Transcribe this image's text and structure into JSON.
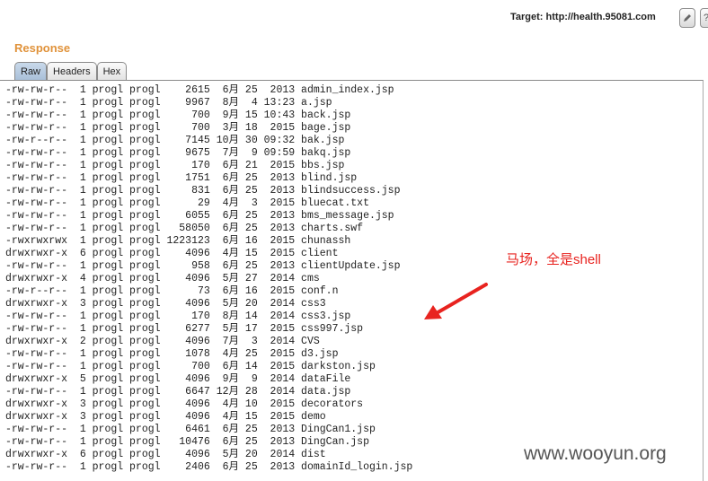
{
  "header": {
    "target_label": "Target: http://health.95081.com",
    "edit_icon": "pencil-icon",
    "help_icon": "help-icon",
    "help_glyph": "?"
  },
  "response": {
    "title": "Response",
    "tabs": [
      {
        "label": "Raw",
        "active": true
      },
      {
        "label": "Headers",
        "active": false
      },
      {
        "label": "Hex",
        "active": false
      }
    ]
  },
  "listing": [
    {
      "perms": "-rw-rw-r--",
      "links": "1",
      "owner": "progl",
      "group": "progl",
      "size": "2615",
      "month": "6月",
      "day": "25",
      "time": "2013",
      "name": "admin_index.jsp"
    },
    {
      "perms": "-rw-rw-r--",
      "links": "1",
      "owner": "progl",
      "group": "progl",
      "size": "9967",
      "month": "8月",
      "day": "4",
      "time": "13:23",
      "name": "a.jsp"
    },
    {
      "perms": "-rw-rw-r--",
      "links": "1",
      "owner": "progl",
      "group": "progl",
      "size": "700",
      "month": "9月",
      "day": "15",
      "time": "10:43",
      "name": "back.jsp"
    },
    {
      "perms": "-rw-rw-r--",
      "links": "1",
      "owner": "progl",
      "group": "progl",
      "size": "700",
      "month": "3月",
      "day": "18",
      "time": "2015",
      "name": "bage.jsp"
    },
    {
      "perms": "-rw-r--r--",
      "links": "1",
      "owner": "progl",
      "group": "progl",
      "size": "7145",
      "month": "10月",
      "day": "30",
      "time": "09:32",
      "name": "bak.jsp"
    },
    {
      "perms": "-rw-rw-r--",
      "links": "1",
      "owner": "progl",
      "group": "progl",
      "size": "9675",
      "month": "7月",
      "day": "9",
      "time": "09:59",
      "name": "bakq.jsp"
    },
    {
      "perms": "-rw-rw-r--",
      "links": "1",
      "owner": "progl",
      "group": "progl",
      "size": "170",
      "month": "6月",
      "day": "21",
      "time": "2015",
      "name": "bbs.jsp"
    },
    {
      "perms": "-rw-rw-r--",
      "links": "1",
      "owner": "progl",
      "group": "progl",
      "size": "1751",
      "month": "6月",
      "day": "25",
      "time": "2013",
      "name": "blind.jsp"
    },
    {
      "perms": "-rw-rw-r--",
      "links": "1",
      "owner": "progl",
      "group": "progl",
      "size": "831",
      "month": "6月",
      "day": "25",
      "time": "2013",
      "name": "blindsuccess.jsp"
    },
    {
      "perms": "-rw-rw-r--",
      "links": "1",
      "owner": "progl",
      "group": "progl",
      "size": "29",
      "month": "4月",
      "day": "3",
      "time": "2015",
      "name": "bluecat.txt"
    },
    {
      "perms": "-rw-rw-r--",
      "links": "1",
      "owner": "progl",
      "group": "progl",
      "size": "6055",
      "month": "6月",
      "day": "25",
      "time": "2013",
      "name": "bms_message.jsp"
    },
    {
      "perms": "-rw-rw-r--",
      "links": "1",
      "owner": "progl",
      "group": "progl",
      "size": "58050",
      "month": "6月",
      "day": "25",
      "time": "2013",
      "name": "charts.swf"
    },
    {
      "perms": "-rwxrwxrwx",
      "links": "1",
      "owner": "progl",
      "group": "progl",
      "size": "1223123",
      "month": "6月",
      "day": "16",
      "time": "2015",
      "name": "chunassh"
    },
    {
      "perms": "drwxrwxr-x",
      "links": "6",
      "owner": "progl",
      "group": "progl",
      "size": "4096",
      "month": "4月",
      "day": "15",
      "time": "2015",
      "name": "client"
    },
    {
      "perms": "-rw-rw-r--",
      "links": "1",
      "owner": "progl",
      "group": "progl",
      "size": "958",
      "month": "6月",
      "day": "25",
      "time": "2013",
      "name": "clientUpdate.jsp"
    },
    {
      "perms": "drwxrwxr-x",
      "links": "4",
      "owner": "progl",
      "group": "progl",
      "size": "4096",
      "month": "5月",
      "day": "27",
      "time": "2014",
      "name": "cms"
    },
    {
      "perms": "-rw-r--r--",
      "links": "1",
      "owner": "progl",
      "group": "progl",
      "size": "73",
      "month": "6月",
      "day": "16",
      "time": "2015",
      "name": "conf.n"
    },
    {
      "perms": "drwxrwxr-x",
      "links": "3",
      "owner": "progl",
      "group": "progl",
      "size": "4096",
      "month": "5月",
      "day": "20",
      "time": "2014",
      "name": "css3"
    },
    {
      "perms": "-rw-rw-r--",
      "links": "1",
      "owner": "progl",
      "group": "progl",
      "size": "170",
      "month": "8月",
      "day": "14",
      "time": "2014",
      "name": "css3.jsp"
    },
    {
      "perms": "-rw-rw-r--",
      "links": "1",
      "owner": "progl",
      "group": "progl",
      "size": "6277",
      "month": "5月",
      "day": "17",
      "time": "2015",
      "name": "css997.jsp"
    },
    {
      "perms": "drwxrwxr-x",
      "links": "2",
      "owner": "progl",
      "group": "progl",
      "size": "4096",
      "month": "7月",
      "day": "3",
      "time": "2014",
      "name": "CVS"
    },
    {
      "perms": "-rw-rw-r--",
      "links": "1",
      "owner": "progl",
      "group": "progl",
      "size": "1078",
      "month": "4月",
      "day": "25",
      "time": "2015",
      "name": "d3.jsp"
    },
    {
      "perms": "-rw-rw-r--",
      "links": "1",
      "owner": "progl",
      "group": "progl",
      "size": "700",
      "month": "6月",
      "day": "14",
      "time": "2015",
      "name": "darkston.jsp"
    },
    {
      "perms": "drwxrwxr-x",
      "links": "5",
      "owner": "progl",
      "group": "progl",
      "size": "4096",
      "month": "9月",
      "day": "9",
      "time": "2014",
      "name": "dataFile"
    },
    {
      "perms": "-rw-rw-r--",
      "links": "1",
      "owner": "progl",
      "group": "progl",
      "size": "6647",
      "month": "12月",
      "day": "28",
      "time": "2014",
      "name": "data.jsp"
    },
    {
      "perms": "drwxrwxr-x",
      "links": "3",
      "owner": "progl",
      "group": "progl",
      "size": "4096",
      "month": "4月",
      "day": "10",
      "time": "2015",
      "name": "decorators"
    },
    {
      "perms": "drwxrwxr-x",
      "links": "3",
      "owner": "progl",
      "group": "progl",
      "size": "4096",
      "month": "4月",
      "day": "15",
      "time": "2015",
      "name": "demo"
    },
    {
      "perms": "-rw-rw-r--",
      "links": "1",
      "owner": "progl",
      "group": "progl",
      "size": "6461",
      "month": "6月",
      "day": "25",
      "time": "2013",
      "name": "DingCan1.jsp"
    },
    {
      "perms": "-rw-rw-r--",
      "links": "1",
      "owner": "progl",
      "group": "progl",
      "size": "10476",
      "month": "6月",
      "day": "25",
      "time": "2013",
      "name": "DingCan.jsp"
    },
    {
      "perms": "drwxrwxr-x",
      "links": "6",
      "owner": "progl",
      "group": "progl",
      "size": "4096",
      "month": "5月",
      "day": "20",
      "time": "2014",
      "name": "dist"
    },
    {
      "perms": "-rw-rw-r--",
      "links": "1",
      "owner": "progl",
      "group": "progl",
      "size": "2406",
      "month": "6月",
      "day": "25",
      "time": "2013",
      "name": "domainId_login.jsp"
    }
  ],
  "annotation": {
    "text": "马场，全是shell",
    "color": "#e8231f"
  },
  "watermark": "www.wooyun.org"
}
